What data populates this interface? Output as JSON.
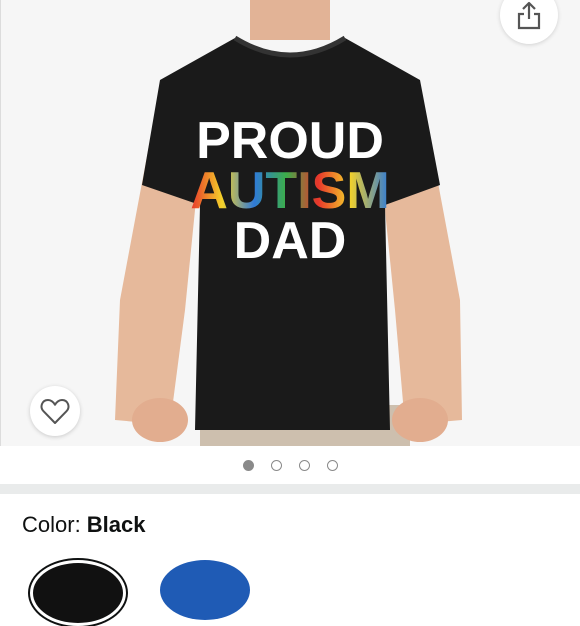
{
  "product": {
    "shirt_text": {
      "line1": "PROUD",
      "line2": "AUTISM",
      "line3": "DAD"
    }
  },
  "carousel": {
    "total": 4,
    "active_index": 0
  },
  "icons": {
    "share": "share-icon",
    "wishlist": "heart-icon"
  },
  "variation": {
    "label": "Color: ",
    "selected_value": "Black",
    "swatches": [
      "black",
      "blue"
    ]
  },
  "colors": {
    "shirt": "#1a1a1a",
    "puzzle_red": "#e8352b",
    "puzzle_blue": "#2f7ad8",
    "puzzle_yellow": "#f4d22a",
    "puzzle_green": "#3cae4a",
    "background": "#f6f6f6"
  }
}
